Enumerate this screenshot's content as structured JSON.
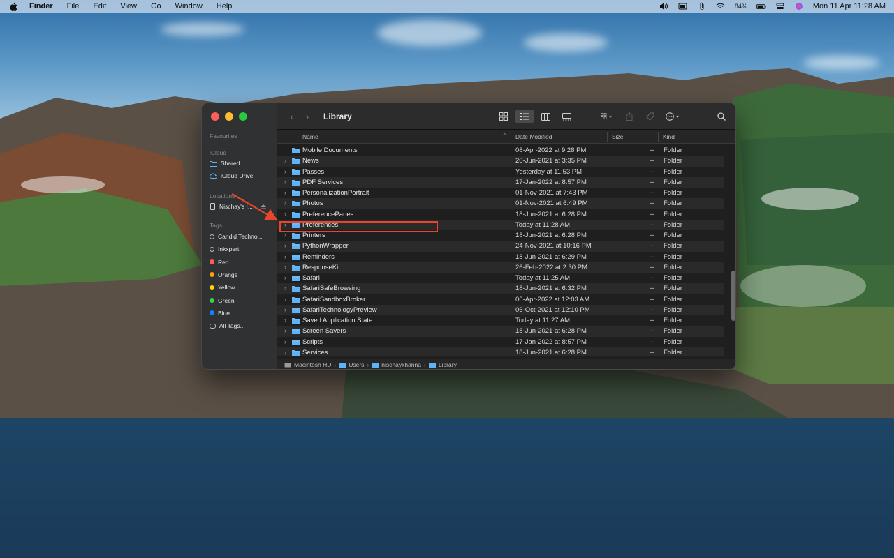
{
  "menubar": {
    "app_name": "Finder",
    "items": [
      "File",
      "Edit",
      "View",
      "Go",
      "Window",
      "Help"
    ],
    "battery": "84%",
    "datetime": "Mon 11 Apr  11:28 AM"
  },
  "window": {
    "title": "Library",
    "sidebar": {
      "favourites_label": "Favourites",
      "icloud_label": "iCloud",
      "icloud_items": [
        "Shared",
        "iCloud Drive"
      ],
      "locations_label": "Locations",
      "locations_item": "Nischay's I...",
      "tags_label": "Tags",
      "tags": [
        {
          "label": "Candid Techno...",
          "color": "hollow"
        },
        {
          "label": "Inkxpert",
          "color": "hollow"
        },
        {
          "label": "Red",
          "color": "#ff5b4f"
        },
        {
          "label": "Orange",
          "color": "#ff9f0a"
        },
        {
          "label": "Yellow",
          "color": "#ffd60a"
        },
        {
          "label": "Green",
          "color": "#32d74b"
        },
        {
          "label": "Blue",
          "color": "#0a84ff"
        },
        {
          "label": "All Tags...",
          "color": "all"
        }
      ]
    },
    "columns": {
      "name": "Name",
      "date": "Date Modified",
      "size": "Size",
      "kind": "Kind"
    },
    "rows": [
      {
        "name": "Mobile Documents",
        "date": "08-Apr-2022 at 9:28 PM",
        "size": "--",
        "kind": "Folder",
        "expandable": false
      },
      {
        "name": "News",
        "date": "20-Jun-2021 at 3:35 PM",
        "size": "--",
        "kind": "Folder",
        "expandable": true
      },
      {
        "name": "Passes",
        "date": "Yesterday at 11:53 PM",
        "size": "--",
        "kind": "Folder",
        "expandable": true
      },
      {
        "name": "PDF Services",
        "date": "17-Jan-2022 at 8:57 PM",
        "size": "--",
        "kind": "Folder",
        "expandable": true
      },
      {
        "name": "PersonalizationPortrait",
        "date": "01-Nov-2021 at 7:43 PM",
        "size": "--",
        "kind": "Folder",
        "expandable": true
      },
      {
        "name": "Photos",
        "date": "01-Nov-2021 at 6:49 PM",
        "size": "--",
        "kind": "Folder",
        "expandable": true
      },
      {
        "name": "PreferencePanes",
        "date": "18-Jun-2021 at 6:28 PM",
        "size": "--",
        "kind": "Folder",
        "expandable": true
      },
      {
        "name": "Preferences",
        "date": "Today at 11:28 AM",
        "size": "--",
        "kind": "Folder",
        "expandable": true
      },
      {
        "name": "Printers",
        "date": "18-Jun-2021 at 6:28 PM",
        "size": "--",
        "kind": "Folder",
        "expandable": true
      },
      {
        "name": "PythonWrapper",
        "date": "24-Nov-2021 at 10:16 PM",
        "size": "--",
        "kind": "Folder",
        "expandable": true
      },
      {
        "name": "Reminders",
        "date": "18-Jun-2021 at 6:29 PM",
        "size": "--",
        "kind": "Folder",
        "expandable": true
      },
      {
        "name": "ResponseKit",
        "date": "26-Feb-2022 at 2:30 PM",
        "size": "--",
        "kind": "Folder",
        "expandable": true
      },
      {
        "name": "Safari",
        "date": "Today at 11:25 AM",
        "size": "--",
        "kind": "Folder",
        "expandable": true
      },
      {
        "name": "SafariSafeBrowsing",
        "date": "18-Jun-2021 at 6:32 PM",
        "size": "--",
        "kind": "Folder",
        "expandable": true
      },
      {
        "name": "SafariSandboxBroker",
        "date": "06-Apr-2022 at 12:03 AM",
        "size": "--",
        "kind": "Folder",
        "expandable": true
      },
      {
        "name": "SafariTechnologyPreview",
        "date": "06-Oct-2021 at 12:10 PM",
        "size": "--",
        "kind": "Folder",
        "expandable": true
      },
      {
        "name": "Saved Application State",
        "date": "Today at 11:27 AM",
        "size": "--",
        "kind": "Folder",
        "expandable": true
      },
      {
        "name": "Screen Savers",
        "date": "18-Jun-2021 at 6:28 PM",
        "size": "--",
        "kind": "Folder",
        "expandable": true
      },
      {
        "name": "Scripts",
        "date": "17-Jan-2022 at 8:57 PM",
        "size": "--",
        "kind": "Folder",
        "expandable": true
      },
      {
        "name": "Services",
        "date": "18-Jun-2021 at 6:28 PM",
        "size": "--",
        "kind": "Folder",
        "expandable": true
      }
    ],
    "pathbar": [
      "Macintosh HD",
      "Users",
      "nischaykhanna",
      "Library"
    ]
  },
  "colors": {
    "folder": "#5fb3f4",
    "highlight": "#e8452c"
  }
}
